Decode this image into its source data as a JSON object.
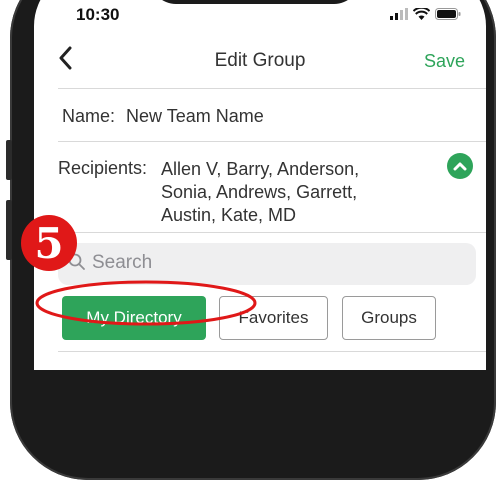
{
  "status_bar": {
    "time": "10:30"
  },
  "nav": {
    "back_icon": "chevron-left-icon",
    "title": "Edit Group",
    "save_label": "Save"
  },
  "group": {
    "name_label": "Name:",
    "name_value": "New Team Name"
  },
  "recipients": {
    "label": "Recipients:",
    "lines": [
      "Allen V, Barry, Anderson,",
      "Sonia, Andrews, Garrett,",
      "Austin, Kate, MD"
    ],
    "collapse_icon": "chevron-up-circle-icon"
  },
  "search": {
    "placeholder": "Search",
    "icon": "search-icon"
  },
  "tabs": [
    {
      "label": "My Directory",
      "selected": true
    },
    {
      "label": "Favorites",
      "selected": false
    },
    {
      "label": "Groups",
      "selected": false
    }
  ],
  "annotation": {
    "step_number": "5",
    "highlight_color": "#e01818"
  },
  "colors": {
    "accent": "#2ea45a",
    "annotation": "#e01818"
  }
}
